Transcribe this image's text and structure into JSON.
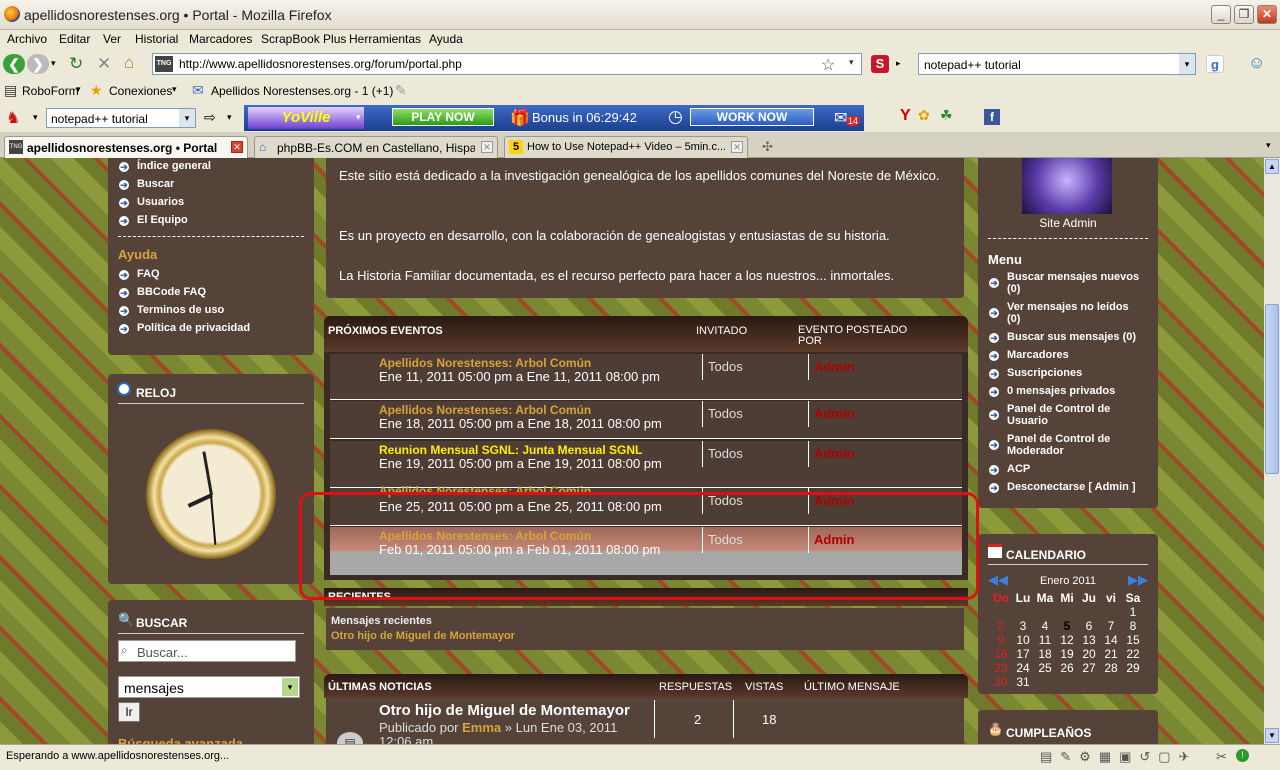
{
  "window": {
    "title": "apellidosnorestenses.org • Portal - Mozilla Firefox"
  },
  "menu": [
    "Archivo",
    "Editar",
    "Ver",
    "Historial",
    "Marcadores",
    "ScrapBook Plus",
    "Herramientas",
    "Ayuda"
  ],
  "nav": {
    "url": "http://www.apellidosnorestenses.org/forum/portal.php",
    "search": "notepad++ tutorial"
  },
  "bookmarks": {
    "roboform": "RoboForm",
    "conexiones": "Conexiones",
    "site": "Apellidos Norestenses.org - 1 (+1)"
  },
  "toolbar2": {
    "search": "notepad++ tutorial",
    "yoville": "YoVille",
    "play": "PLAY NOW",
    "bonus": "Bonus in 06:29:42",
    "work": "WORK NOW",
    "mail_count": "14"
  },
  "tabs": [
    {
      "label": "apellidosnorestenses.org • Portal"
    },
    {
      "label": "phpBB-Es.COM en Castellano, Hispano ..."
    },
    {
      "label": "How to Use Notepad++ Video – 5min.c..."
    }
  ],
  "left": {
    "nav_links": [
      "Índice general",
      "Buscar",
      "Usuarios",
      "El Equipo"
    ],
    "help_title": "Ayuda",
    "help_links": [
      "FAQ",
      "BBCode FAQ",
      "Terminos de uso",
      "Política de privacidad"
    ],
    "clock_title": "RELOJ",
    "search_title": "BUSCAR",
    "search_placeholder": "Buscar...",
    "search_select": "mensajes",
    "search_go": "Ir",
    "advanced": "Búsqueda avanzada"
  },
  "center": {
    "intro": [
      "Este sitio está dedicado a la investigación genealógica de los apellidos comunes del Noreste de México.",
      "Es un proyecto en desarrollo, con la colaboración de genealogistas y entusiastas de su historia.",
      "La Historia Familiar documentada, es el recurso perfecto para hacer a los nuestros... inmortales."
    ],
    "events_header": {
      "title": "PRÓXIMOS EVENTOS",
      "invited": "INVITADO",
      "posted_by": "EVENTO POSTEADO POR"
    },
    "events": [
      {
        "title": "Apellidos Norestenses: Arbol Común",
        "date": "Ene 11, 2011 05:00 pm a Ene 11, 2011 08:00 pm",
        "invited": "Todos",
        "by": "Admin"
      },
      {
        "title": "Apellidos Norestenses: Arbol Común",
        "date": "Ene 18, 2011 05:00 pm a Ene 18, 2011 08:00 pm",
        "invited": "Todos",
        "by": "Admin"
      },
      {
        "title": "Reunion Mensual SGNL: Junta Mensual SGNL",
        "date": "Ene 19, 2011 05:00 pm a Ene 19, 2011 08:00 pm",
        "invited": "Todos",
        "by": "Admin"
      },
      {
        "title": "Apellidos Norestenses: Arbol Común",
        "date": "Ene 25, 2011 05:00 pm a Ene 25, 2011 08:00 pm",
        "invited": "Todos",
        "by": "Admin"
      },
      {
        "title": "Apellidos Norestenses: Arbol Común",
        "date": "Feb 01, 2011 05:00 pm a Feb 01, 2011 08:00 pm",
        "invited": "Todos",
        "by": "Admin"
      }
    ],
    "recent_title": "RECIENTES",
    "recent_sub": "Mensajes recientes",
    "recent_item": "Otro hijo de Miguel de Montemayor",
    "news_header": {
      "title": "ÚLTIMAS NOTICIAS",
      "replies": "RESPUESTAS",
      "views": "VISTAS",
      "last": "ÚLTIMO MENSAJE"
    },
    "news": {
      "title": "Otro hijo de Miguel de Montemayor",
      "posted_prefix": "Publicado por",
      "author": "Emma",
      "date": "» Lun Ene 03, 2011",
      "time": "12:06 am",
      "replies": "2",
      "views": "18"
    }
  },
  "right": {
    "admin_caption": "Site Admin",
    "menu_title": "Menu",
    "menu_links": [
      "Buscar mensajes nuevos (0)",
      "Ver mensajes no leídos (0)",
      "Buscar sus mensajes (0)",
      "Marcadores",
      "Suscripciones",
      "0 mensajes privados",
      "Panel de Control de Usuario",
      "Panel de Control de Moderador",
      "ACP",
      "Desconectarse [ Admin ]"
    ],
    "calendar_title": "CALENDARIO",
    "month": "Enero 2011",
    "weekdays": [
      "Do",
      "Lu",
      "Ma",
      "Mi",
      "Ju",
      "vi",
      "Sa"
    ],
    "days": [
      "",
      "",
      "",
      "",
      "",
      "",
      "1",
      "2",
      "3",
      "4",
      "5",
      "6",
      "7",
      "8",
      "9",
      "10",
      "11",
      "12",
      "13",
      "14",
      "15",
      "16",
      "17",
      "18",
      "19",
      "20",
      "21",
      "22",
      "23",
      "24",
      "25",
      "26",
      "27",
      "28",
      "29",
      "30",
      "31"
    ],
    "birthday_title": "CUMPLEAÑOS"
  },
  "status": {
    "text": "Esperando a www.apellidosnorestenses.org..."
  },
  "colors": {
    "panel": "#55433a",
    "event_title": "#d6a43a",
    "admin_red": "#b10000",
    "highlight": "#e01010"
  }
}
